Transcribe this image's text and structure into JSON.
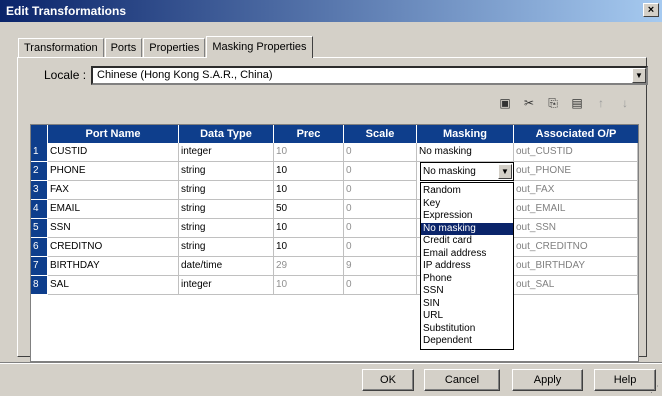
{
  "window": {
    "title": "Edit Transformations",
    "close_label": "×"
  },
  "tabs": [
    "Transformation",
    "Ports",
    "Properties",
    "Masking Properties"
  ],
  "locale": {
    "label": "Locale :",
    "value": "Chinese (Hong Kong S.A.R., China)"
  },
  "toolbar": [
    "new-icon",
    "cut-icon",
    "copy-icon",
    "paste-icon",
    "move-up-icon",
    "move-down-icon"
  ],
  "grid": {
    "headers": [
      "Port Name",
      "Data Type",
      "Prec",
      "Scale",
      "Masking",
      "Associated O/P"
    ],
    "rows": [
      {
        "num": "1",
        "port": "CUSTID",
        "type": "integer",
        "prec": "10",
        "scale": "0",
        "masking": "No masking",
        "assoc": "out_CUSTID"
      },
      {
        "num": "2",
        "port": "PHONE",
        "type": "string",
        "prec": "10",
        "scale": "0",
        "masking": "No masking",
        "assoc": "out_PHONE"
      },
      {
        "num": "3",
        "port": "FAX",
        "type": "string",
        "prec": "10",
        "scale": "0",
        "masking": "",
        "assoc": "out_FAX"
      },
      {
        "num": "4",
        "port": "EMAIL",
        "type": "string",
        "prec": "50",
        "scale": "0",
        "masking": "",
        "assoc": "out_EMAIL"
      },
      {
        "num": "5",
        "port": "SSN",
        "type": "string",
        "prec": "10",
        "scale": "0",
        "masking": "",
        "assoc": "out_SSN"
      },
      {
        "num": "6",
        "port": "CREDITNO",
        "type": "string",
        "prec": "10",
        "scale": "0",
        "masking": "",
        "assoc": "out_CREDITNO"
      },
      {
        "num": "7",
        "port": "BIRTHDAY",
        "type": "date/time",
        "prec": "29",
        "scale": "9",
        "masking": "",
        "assoc": "out_BIRTHDAY"
      },
      {
        "num": "8",
        "port": "SAL",
        "type": "integer",
        "prec": "10",
        "scale": "0",
        "masking": "",
        "assoc": "out_SAL"
      }
    ]
  },
  "masking_dropdown": {
    "current": "No masking",
    "selected": "No masking",
    "options": [
      "Random",
      "Key",
      "Expression",
      "No masking",
      "Credit card",
      "Email address",
      "IP address",
      "Phone",
      "SSN",
      "SIN",
      "URL",
      "Substitution",
      "Dependent"
    ]
  },
  "buttons": {
    "ok": "OK",
    "cancel": "Cancel",
    "apply": "Apply",
    "help": "Help"
  },
  "colors": {
    "header_bg": "#0e3e8c",
    "title_bg": "#0a246a",
    "selection": "#0a246a"
  }
}
